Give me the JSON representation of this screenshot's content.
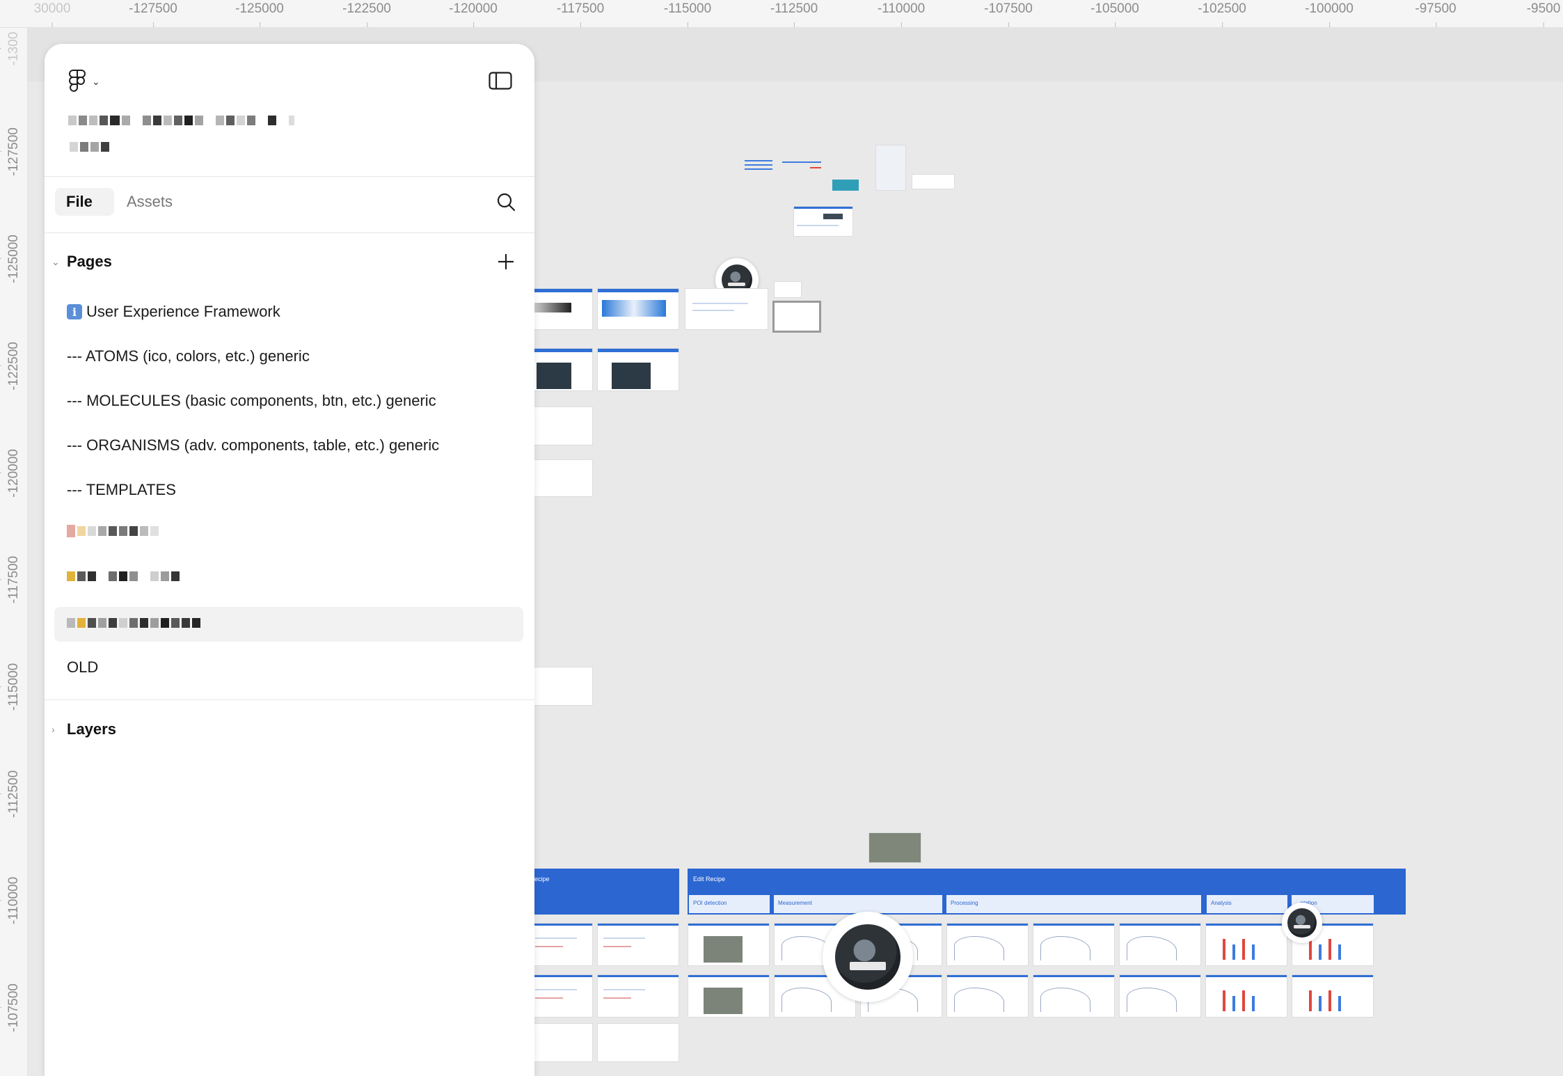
{
  "ruler": {
    "top": [
      "30000",
      "-127500",
      "-125000",
      "-122500",
      "-120000",
      "-117500",
      "-115000",
      "-112500",
      "-110000",
      "-107500",
      "-105000",
      "-102500",
      "-100000",
      "-97500",
      "-9500"
    ],
    "left": [
      "-1300",
      "-127500",
      "-125000",
      "-122500",
      "-120000",
      "-117500",
      "-115000",
      "-112500",
      "-110000",
      "-107500"
    ]
  },
  "panel": {
    "tabs": {
      "file": "File",
      "assets": "Assets"
    },
    "pages_section": {
      "label": "Pages"
    },
    "pages": [
      {
        "label": "User Experience Framework",
        "icon": "info-icon"
      },
      {
        "label": "--- ATOMS (ico, colors, etc.) generic"
      },
      {
        "label": "--- MOLECULES (basic components, btn, etc.) generic"
      },
      {
        "label": "--- ORGANISMS (adv. components, table, etc.) generic"
      },
      {
        "label": "--- TEMPLATES"
      },
      {
        "label": "OLD"
      }
    ],
    "layers_section": {
      "label": "Layers"
    },
    "icons": {
      "logo": "figma-logo-icon",
      "toggle": "sidebar-toggle-icon",
      "search": "search-icon",
      "add": "plus-icon"
    }
  },
  "canvas": {
    "band_left": {
      "title": "ecipe"
    },
    "band_main": {
      "title": "Edit Recipe"
    },
    "sub_bands": [
      "POI detection",
      "Measurement",
      "Processing",
      "Analysis",
      "...ntation"
    ]
  },
  "colors": {
    "accent": "#2b66d1",
    "canvas": "#e9e9e9",
    "panel": "#ffffff"
  }
}
